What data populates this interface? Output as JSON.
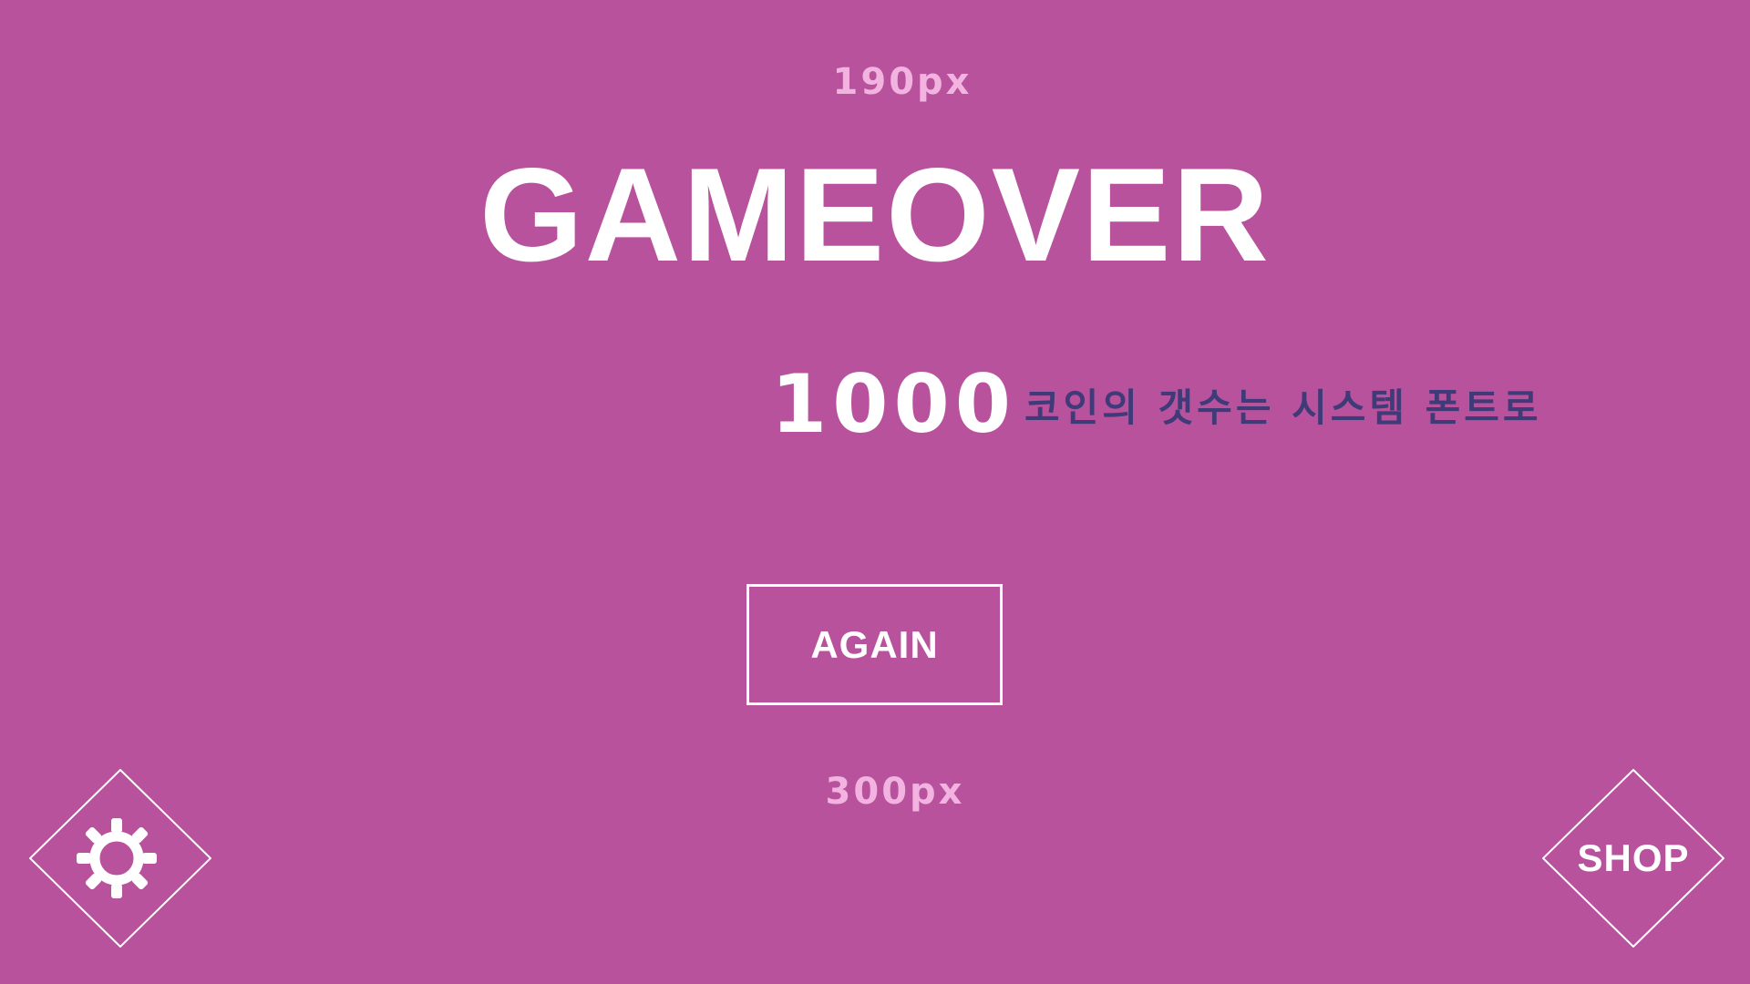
{
  "screen": {
    "background_color": "#b8529c",
    "accent_text_color": "#ffffff",
    "hint_text_color": "#f2b3e1",
    "note_text_color": "#3f3a78"
  },
  "annotations": {
    "top_spacing_label": "190px",
    "bottom_spacing_label": "300px"
  },
  "title": "GAMEOVER",
  "coins": {
    "count": "1000",
    "note": "코인의 갯수는 시스템 폰트로"
  },
  "buttons": {
    "again_label": "AGAIN",
    "shop_label": "SHOP",
    "settings_icon": "gear-icon"
  }
}
